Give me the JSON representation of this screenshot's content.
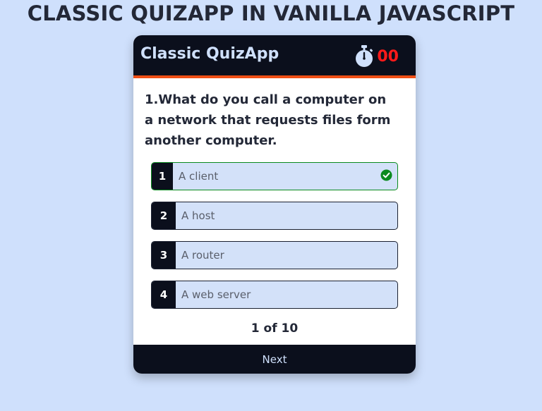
{
  "page": {
    "title": "CLASSIC QUIZAPP IN VANILLA JAVASCRIPT"
  },
  "quiz": {
    "app_name": "Classic QuizApp",
    "timer_icon": "stopwatch-icon",
    "timer_value": "00",
    "question": "1.What do you call a computer on a network that requests files form another computer.",
    "options": [
      {
        "number": "1",
        "text": "A client",
        "status": "correct",
        "icon": "check-circle-icon"
      },
      {
        "number": "2",
        "text": "A host"
      },
      {
        "number": "3",
        "text": "A router"
      },
      {
        "number": "4",
        "text": "A web server"
      }
    ],
    "counter": "1 of 10",
    "next_label": "Next"
  },
  "colors": {
    "background": "#cfe0fc",
    "header": "#0b0f1c",
    "accent": "#f04e14",
    "timer": "#ff1a1a",
    "correct": "#0a8a1e"
  }
}
